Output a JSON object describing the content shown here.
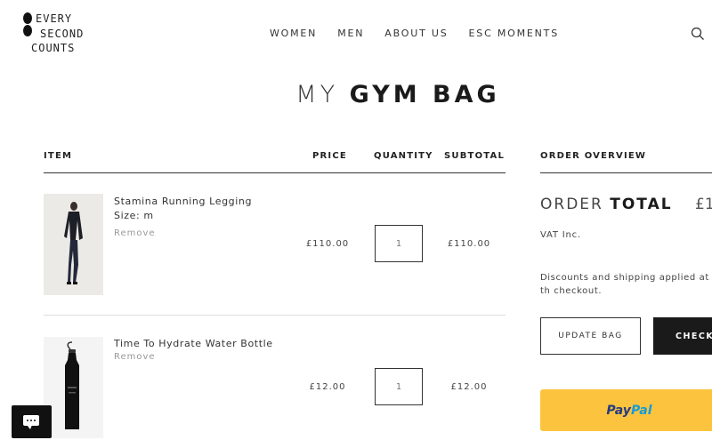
{
  "brand": {
    "line1": "EVERY",
    "line2": "SECOND",
    "line3": "COUNTS"
  },
  "nav": [
    "WOMEN",
    "MEN",
    "ABOUT US",
    "ESC MOMENTS"
  ],
  "page_title": {
    "light": "MY",
    "bold": "GYM BAG"
  },
  "table": {
    "headers": {
      "item": "ITEM",
      "price": "PRICE",
      "quantity": "QUANTITY",
      "subtotal": "SUBTOTAL"
    },
    "rows": [
      {
        "name": "Stamina Running Legging",
        "size": "Size: m",
        "remove": "Remove",
        "price": "£110.00",
        "qty": "1",
        "subtotal": "£110.00"
      },
      {
        "name": "Time To Hydrate Water Bottle",
        "remove": "Remove",
        "price": "£12.00",
        "qty": "1",
        "subtotal": "£12.00"
      }
    ]
  },
  "overview": {
    "heading": "ORDER OVERVIEW",
    "total_label_light": "ORDER",
    "total_label_bold": "TOTAL",
    "total_value": "£1",
    "vat": "VAT Inc.",
    "note": "Discounts and shipping applied at th checkout.",
    "update_label": "UPDATE BAG",
    "checkout_label": "CHECK",
    "paypal_part1": "Pay",
    "paypal_part2": "Pal"
  },
  "colors": {
    "paypal_yellow": "#fcc43e",
    "checkout_black": "#1a1a1a"
  }
}
